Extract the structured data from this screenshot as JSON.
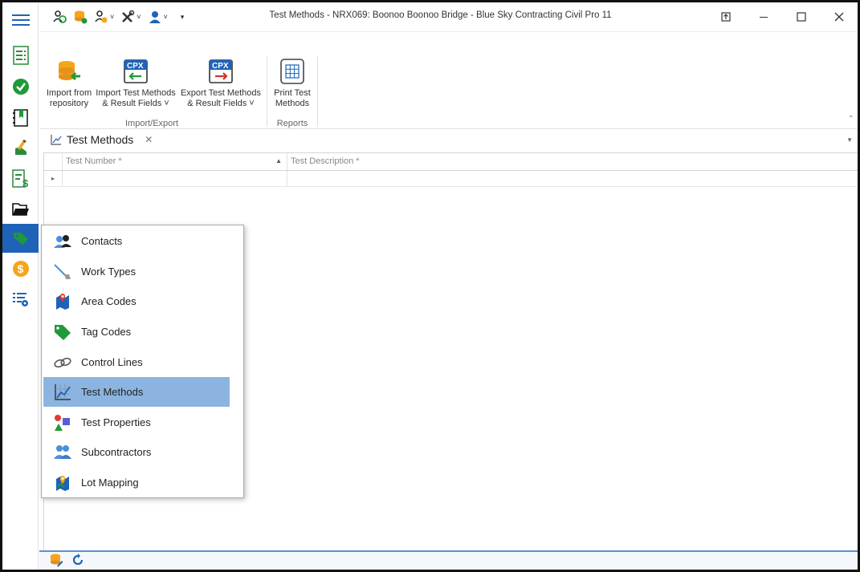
{
  "window": {
    "title": "Test Methods - NRX069: Boonoo Boonoo Bridge  - Blue Sky Contracting Civil Pro 11"
  },
  "rail": {
    "items": [
      {
        "icon": "hamburger-menu-icon"
      },
      {
        "icon": "checklist-icon"
      },
      {
        "icon": "green-check-icon"
      },
      {
        "icon": "bookmark-book-icon"
      },
      {
        "icon": "pencil-hand-icon"
      },
      {
        "icon": "invoice-dollar-icon"
      },
      {
        "icon": "open-folder-icon"
      },
      {
        "icon": "tag-icon",
        "active": true
      },
      {
        "icon": "dollar-coin-icon"
      },
      {
        "icon": "settings-list-icon"
      }
    ]
  },
  "ribbon": {
    "groups": [
      {
        "label": "Import/Export",
        "buttons": [
          {
            "label1": "Import from",
            "label2": "repository",
            "icon": "database-import-icon"
          },
          {
            "label1": "Import Test Methods",
            "label2": "& Result Fields ˅",
            "icon": "cpx-import-icon"
          },
          {
            "label1": "Export Test Methods",
            "label2": "& Result Fields ˅",
            "icon": "cpx-export-icon"
          }
        ]
      },
      {
        "label": "Reports",
        "buttons": [
          {
            "label1": "Print Test",
            "label2": "Methods",
            "icon": "print-grid-icon"
          }
        ]
      }
    ]
  },
  "doc_tab": {
    "title": "Test Methods"
  },
  "grid": {
    "columns": [
      "Test Number *",
      "Test Description *"
    ]
  },
  "popup_menu": {
    "items": [
      {
        "label": "Contacts",
        "icon": "contacts-icon"
      },
      {
        "label": "Work Types",
        "icon": "work-types-icon"
      },
      {
        "label": "Area Codes",
        "icon": "map-pin-icon"
      },
      {
        "label": "Tag Codes",
        "icon": "tag-icon"
      },
      {
        "label": "Control Lines",
        "icon": "chain-link-icon"
      },
      {
        "label": "Test Methods",
        "icon": "chart-icon",
        "selected": true
      },
      {
        "label": "Test Properties",
        "icon": "shapes-icon"
      },
      {
        "label": "Subcontractors",
        "icon": "subcontractors-icon"
      },
      {
        "label": "Lot Mapping",
        "icon": "lot-map-icon"
      }
    ]
  },
  "colors": {
    "accent": "#1e63b8",
    "menu_selected": "#8cb4e0"
  }
}
